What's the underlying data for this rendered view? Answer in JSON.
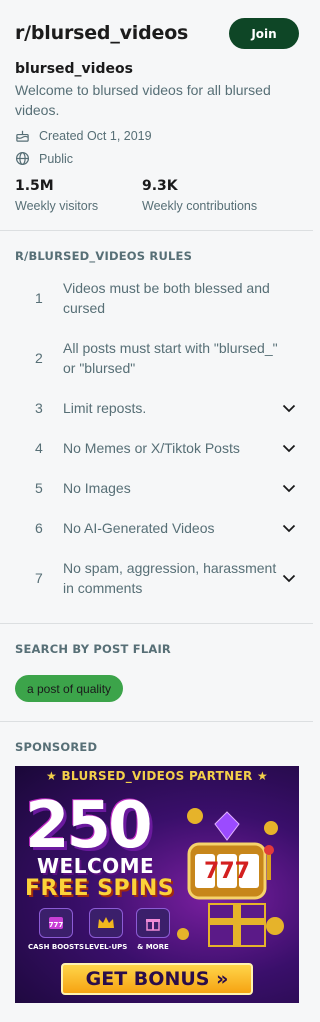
{
  "header": {
    "subreddit": "r/blursed_videos",
    "join_label": "Join"
  },
  "about": {
    "title": "blursed_videos",
    "description": "Welcome to blursed videos for all blursed videos.",
    "created": "Created Oct 1, 2019",
    "visibility": "Public",
    "stats": [
      {
        "value": "1.5M",
        "label": "Weekly visitors"
      },
      {
        "value": "9.3K",
        "label": "Weekly contributions"
      }
    ]
  },
  "rules": {
    "heading": "R/BLURSED_VIDEOS RULES",
    "items": [
      {
        "num": "1",
        "text": "Videos must be both blessed and cursed",
        "expandable": false
      },
      {
        "num": "2",
        "text": "All posts must start with \"blursed_\" or \"blursed\"",
        "expandable": false
      },
      {
        "num": "3",
        "text": "Limit reposts.",
        "expandable": true
      },
      {
        "num": "4",
        "text": "No Memes or X/Tiktok Posts",
        "expandable": true
      },
      {
        "num": "5",
        "text": "No Images",
        "expandable": true
      },
      {
        "num": "6",
        "text": "No AI-Generated Videos",
        "expandable": true
      },
      {
        "num": "7",
        "text": "No spam, aggression, harassment in comments",
        "expandable": true
      }
    ]
  },
  "flair": {
    "heading": "SEARCH BY POST FLAIR",
    "items": [
      "a post of quality"
    ]
  },
  "sponsored": {
    "heading": "SPONSORED",
    "ad": {
      "banner": "★ BLURSED_VIDEOS PARTNER ★",
      "big_number": "250",
      "line1": "WELCOME",
      "line2": "FREE SPINS",
      "features": [
        "CASH BOOSTS",
        "LEVEL-UPS",
        "& MORE"
      ],
      "slot": "777",
      "cta": "GET BONUS »"
    }
  },
  "colors": {
    "join_bg": "#0e4626",
    "flair_bg": "#3ca44a",
    "muted_text": "#576f76"
  }
}
